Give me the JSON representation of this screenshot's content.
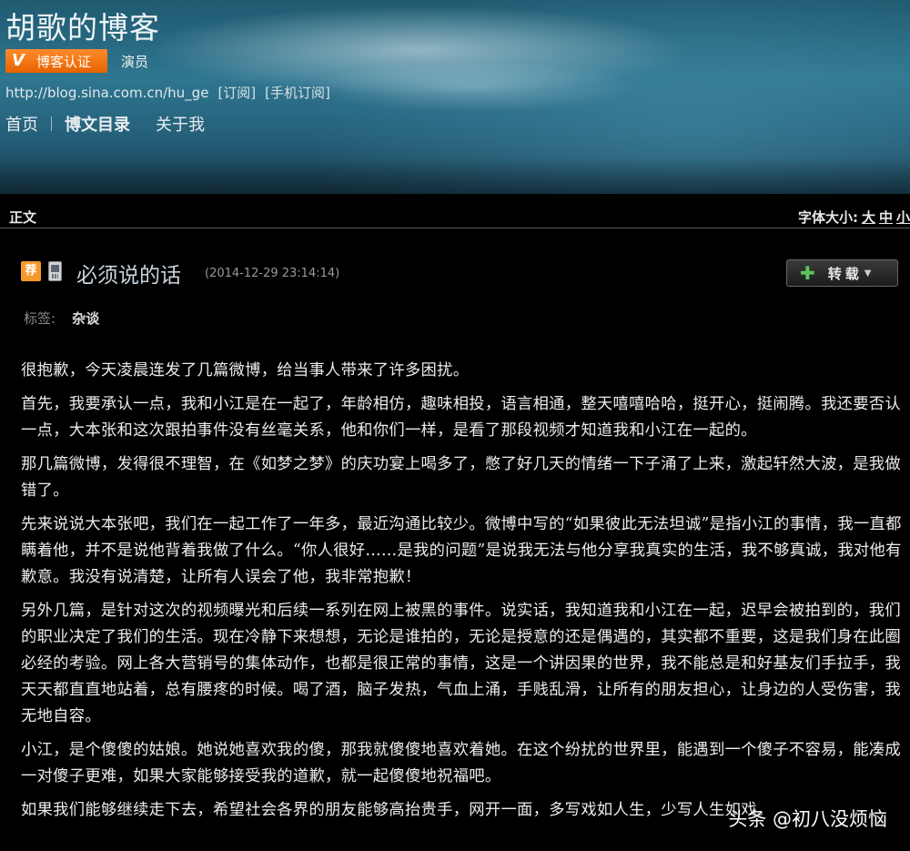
{
  "header": {
    "blog_title": "胡歌的博客",
    "badge_label": "博客认证",
    "badge_icon": "v-icon",
    "role": "演员",
    "url": "http://blog.sina.com.cn/hu_ge",
    "subscribe": "[订阅]",
    "mobile_subscribe": "[手机订阅]",
    "nav": [
      "首页",
      "博文目录",
      "关于我"
    ]
  },
  "article_bar": {
    "label": "正文",
    "font_size_label": "字体大小:",
    "font_size_options": [
      "大",
      "中",
      "小"
    ]
  },
  "post": {
    "recommend_badge": "荐",
    "title": "必须说的话",
    "time": "(2014-12-29 23:14:14)",
    "repost_label": "转载",
    "tag_label": "标签:",
    "tag": "杂谈",
    "paragraphs": [
      "很抱歉，今天凌晨连发了几篇微博，给当事人带来了许多困扰。",
      "首先，我要承认一点，我和小江是在一起了，年龄相仿，趣味相投，语言相通，整天嘻嘻哈哈，挺开心，挺闹腾。我还要否认一点，大本张和这次跟拍事件没有丝毫关系，他和你们一样，是看了那段视频才知道我和小江在一起的。",
      "那几篇微博，发得很不理智，在《如梦之梦》的庆功宴上喝多了，憋了好几天的情绪一下子涌了上来，激起轩然大波，是我做错了。",
      "先来说说大本张吧，我们在一起工作了一年多，最近沟通比较少。微博中写的“如果彼此无法坦诚”是指小江的事情，我一直都瞒着他，并不是说他背着我做了什么。“你人很好……是我的问题”是说我无法与他分享我真实的生活，我不够真诚，我对他有歉意。我没有说清楚，让所有人误会了他，我非常抱歉！",
      "另外几篇，是针对这次的视频曝光和后续一系列在网上被黑的事件。说实话，我知道我和小江在一起，迟早会被拍到的，我们的职业决定了我们的生活。现在冷静下来想想，无论是谁拍的，无论是授意的还是偶遇的，其实都不重要，这是我们身在此圈必经的考验。网上各大营销号的集体动作，也都是很正常的事情，这是一个讲因果的世界，我不能总是和好基友们手拉手，我天天都直直地站着，总有腰疼的时候。喝了酒，脑子发热，气血上涌，手贱乱滑，让所有的朋友担心，让身边的人受伤害，我无地自容。",
      "小江，是个傻傻的姑娘。她说她喜欢我的傻，那我就傻傻地喜欢着她。在这个纷扰的世界里，能遇到一个傻子不容易，能凑成一对傻子更难，如果大家能够接受我的道歉，就一起傻傻地祝福吧。",
      "如果我们能够继续走下去，希望社会各界的朋友能够高抬贵手，网开一面，多写戏如人生，少写人生如戏。"
    ]
  },
  "watermark": "头条 @初八没烦恼"
}
